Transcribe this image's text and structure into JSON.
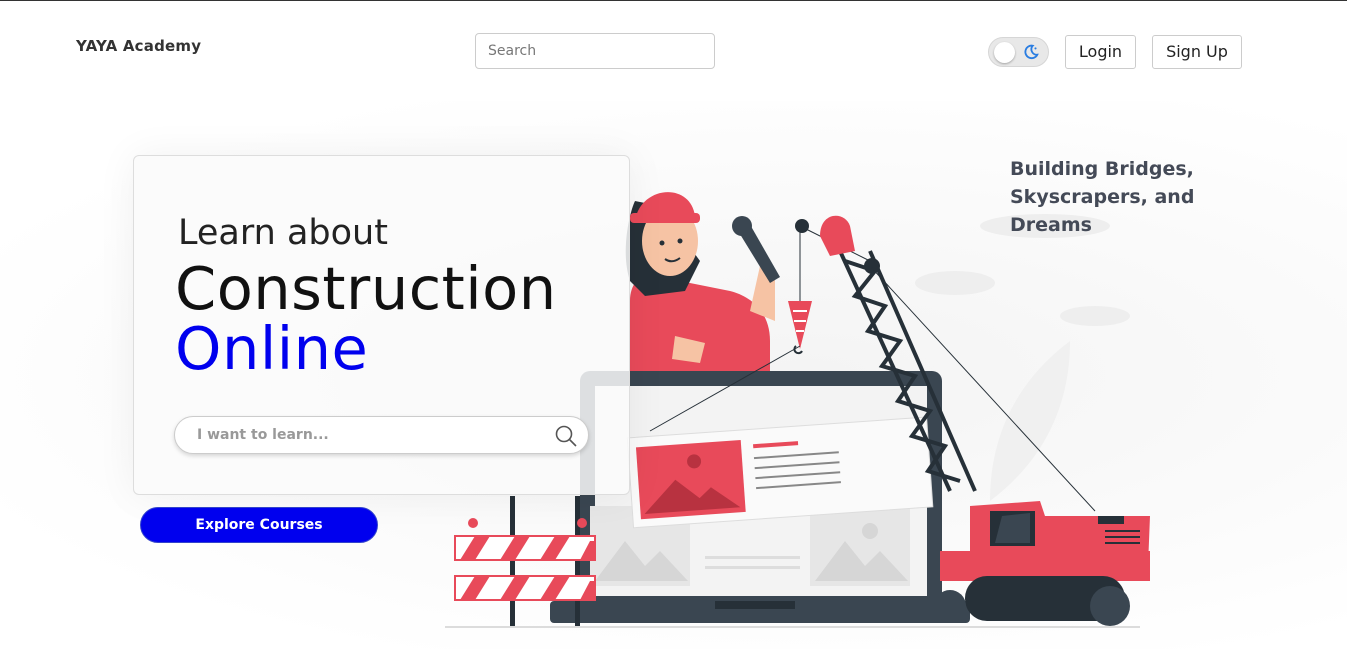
{
  "nav": {
    "brand": "YAYA Academy",
    "search_placeholder": "Search",
    "login_label": "Login",
    "signup_label": "Sign Up"
  },
  "hero": {
    "heading_line1": "Learn about",
    "heading_line2": "Construction",
    "heading_line3": "Online",
    "learn_placeholder": "I want to learn...",
    "explore_label": "Explore Courses",
    "tagline": "Building Bridges, Skyscrapers, and Dreams"
  },
  "colors": {
    "accent": "#0000ee",
    "illustration_red": "#e84a5a",
    "dark": "#2f3b45"
  }
}
